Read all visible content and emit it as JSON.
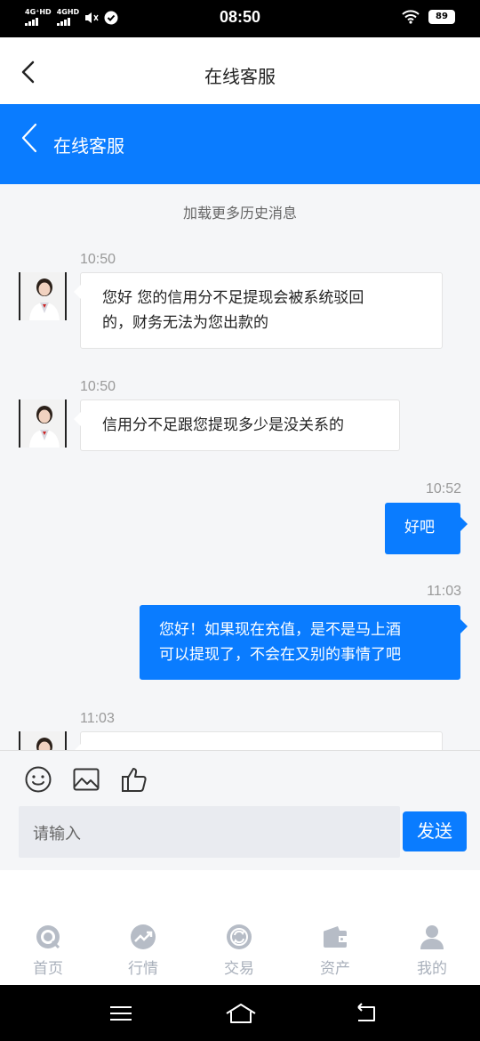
{
  "status_bar": {
    "network1": "4G⁺HD",
    "network2": "4GHD",
    "time": "08:50",
    "battery": "89"
  },
  "header": {
    "title": "在线客服"
  },
  "service_header": {
    "title": "在线客服"
  },
  "chat": {
    "load_more": "加载更多历史消息",
    "messages": [
      {
        "from": "agent",
        "time": "10:50",
        "text_line1": "您好 您的信用分不足提现会被系统驳回",
        "text_line2": "的，财务无法为您出款的"
      },
      {
        "from": "agent",
        "time": "10:50",
        "text": "信用分不足跟您提现多少是没关系的"
      },
      {
        "from": "user",
        "time": "10:52",
        "text": "好吧"
      },
      {
        "from": "user",
        "time": "11:03",
        "text_line1": "您好！如果现在充值，是不是马上酒",
        "text_line2": "可以提现了，不会在又别的事情了吧"
      },
      {
        "from": "agent",
        "time": "11:03",
        "text": ""
      }
    ]
  },
  "composer": {
    "placeholder": "请输入",
    "send_label": "发送",
    "tools": [
      "emoji-icon",
      "image-icon",
      "thumbs-up-icon"
    ]
  },
  "tabbar": {
    "items": [
      {
        "label": "首页",
        "icon": "home-icon"
      },
      {
        "label": "行情",
        "icon": "market-icon"
      },
      {
        "label": "交易",
        "icon": "trade-icon"
      },
      {
        "label": "资产",
        "icon": "wallet-icon"
      },
      {
        "label": "我的",
        "icon": "profile-icon"
      }
    ]
  },
  "colors": {
    "accent": "#0a7cff",
    "tab_inactive": "#a9b0bb",
    "chat_bg": "#f5f6f8"
  }
}
